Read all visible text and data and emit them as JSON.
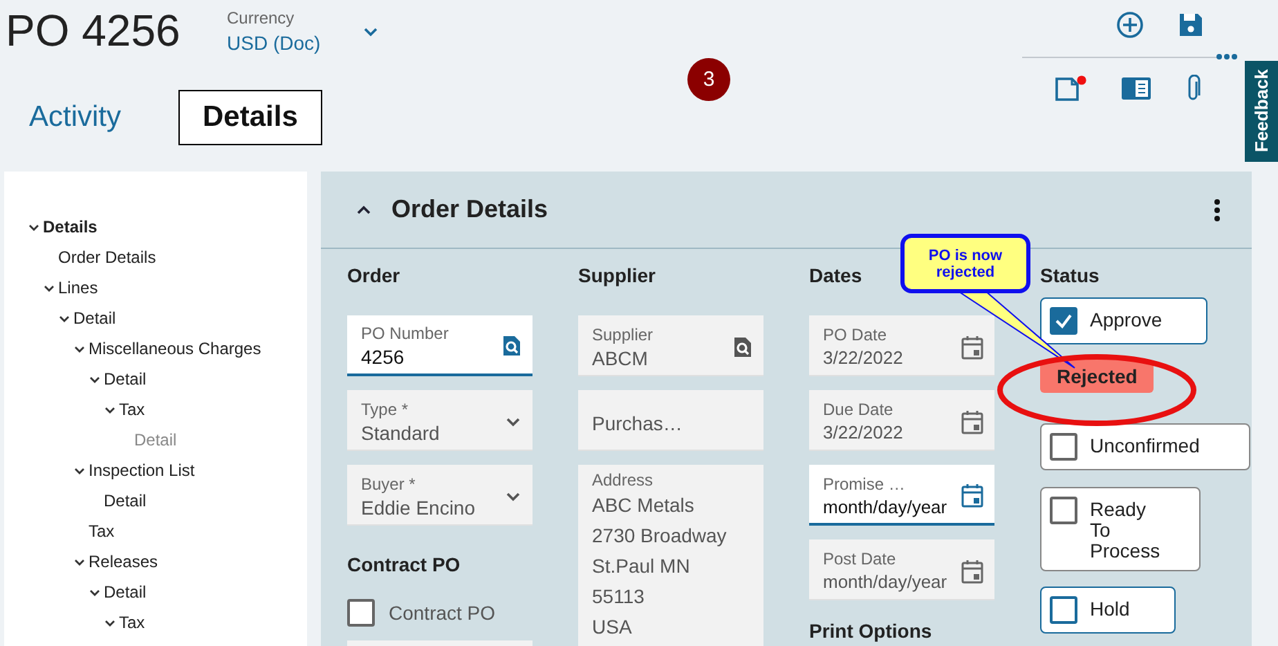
{
  "header": {
    "title": "PO 4256",
    "currency": {
      "label": "Currency",
      "value": "USD (Doc)"
    },
    "badge": "3"
  },
  "tabs": [
    {
      "label": "Activity",
      "selected": false
    },
    {
      "label": "Details",
      "selected": true
    }
  ],
  "feedback": "Feedback",
  "tree": [
    {
      "label": "Details",
      "expanded": true,
      "disabled": false,
      "children": [
        {
          "label": "Order Details",
          "disabled": false
        },
        {
          "label": "Lines",
          "expanded": true,
          "disabled": false,
          "children": [
            {
              "label": "Detail",
              "expanded": true,
              "disabled": false,
              "children": [
                {
                  "label": "Miscellaneous Charges",
                  "expanded": true,
                  "disabled": false,
                  "children": [
                    {
                      "label": "Detail",
                      "expanded": true,
                      "disabled": false,
                      "children": [
                        {
                          "label": "Tax",
                          "expanded": true,
                          "disabled": false,
                          "children": [
                            {
                              "label": "Detail",
                              "disabled": true
                            }
                          ]
                        }
                      ]
                    }
                  ]
                },
                {
                  "label": "Inspection List",
                  "expanded": true,
                  "disabled": false,
                  "children": [
                    {
                      "label": "Detail",
                      "disabled": false
                    }
                  ]
                },
                {
                  "label": "Tax",
                  "disabled": false
                },
                {
                  "label": "Releases",
                  "expanded": true,
                  "disabled": false,
                  "children": [
                    {
                      "label": "Detail",
                      "expanded": true,
                      "disabled": false,
                      "children": [
                        {
                          "label": "Tax",
                          "expanded": true,
                          "disabled": false
                        }
                      ]
                    }
                  ]
                }
              ]
            }
          ]
        }
      ]
    }
  ],
  "panel": {
    "title": "Order Details",
    "expanded": true,
    "columns": [
      {
        "sections": [
          {
            "heading": "Order",
            "items": [
              {
                "kind": "lookup",
                "label": "PO Number",
                "value": "4256",
                "active": true
              },
              {
                "kind": "select",
                "label": "Type *",
                "value": "Standard",
                "active": false
              },
              {
                "kind": "select",
                "label": "Buyer *",
                "value": "Eddie Encino",
                "active": false
              }
            ]
          },
          {
            "heading": "Contract PO",
            "items": [
              {
                "kind": "checkbox",
                "label": "Contract PO",
                "checked": false
              },
              {
                "kind": "text",
                "active": false
              }
            ]
          }
        ]
      },
      {
        "sections": [
          {
            "heading": "Supplier",
            "items": [
              {
                "kind": "lookup",
                "label": "Supplier",
                "value": "ABCM",
                "active": false
              },
              {
                "kind": "text",
                "value": "Purchas…",
                "active": false
              },
              {
                "kind": "address",
                "label": "Address",
                "lines": [
                  "ABC Metals",
                  "2730 Broadway",
                  "St.Paul MN",
                  "55113",
                  "USA"
                ]
              }
            ]
          }
        ]
      },
      {
        "sections": [
          {
            "heading": "Dates",
            "items": [
              {
                "kind": "date",
                "label": "PO Date",
                "value": "3/22/2022",
                "active": false
              },
              {
                "kind": "date",
                "label": "Due Date",
                "value": "3/22/2022",
                "active": false
              },
              {
                "kind": "date",
                "label": "Promise …",
                "value": "month/day/year",
                "active": true
              },
              {
                "kind": "date",
                "label": "Post Date",
                "value": "month/day/year",
                "active": false
              }
            ]
          },
          {
            "heading": "Print Options"
          }
        ]
      },
      {
        "sections": [
          {
            "heading": "Status",
            "items": [
              {
                "kind": "status-check",
                "label": "Approve",
                "checked": true,
                "active": true
              },
              {
                "kind": "status-badge",
                "label": "Rejected"
              },
              {
                "kind": "status-check",
                "label": "Unconfirmed",
                "checked": false,
                "active": false
              },
              {
                "kind": "status-check",
                "label": "Ready To Process",
                "checked": false,
                "active": false
              },
              {
                "kind": "status-check",
                "label": "Hold",
                "checked": false,
                "active": true
              }
            ]
          }
        ]
      }
    ]
  },
  "annotation": {
    "text": "PO is now rejected"
  }
}
